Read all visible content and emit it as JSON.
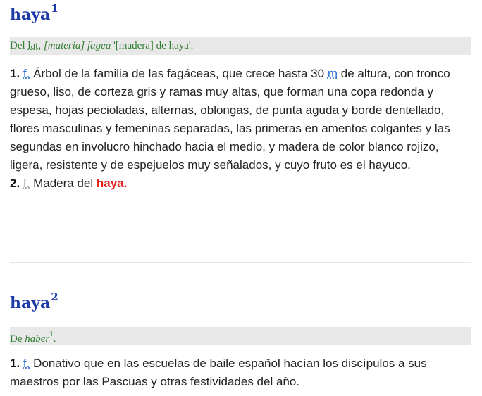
{
  "entries": [
    {
      "word": "haya",
      "sup": "1",
      "etym": {
        "pre": "Del",
        "lang_abbr": "lat.",
        "latin_word": "[materia] fagea",
        "gloss": "'[madera] de haya'."
      },
      "senses": [
        {
          "num": "1.",
          "abbr": "f.",
          "pre": "Árbol de la familia de las fagáceas, que crece hasta 30",
          "unit_abbr": "m",
          "post": "de altura, con tronco grueso, liso, de corteza gris y ramas muy altas, que forman una copa redonda y espesa, hojas pecioladas, alternas, oblongas, de punta aguda y borde dentellado, flores masculinas y femeninas separadas, las primeras en amentos colgantes y las segundas en involucro hinchado hacia el medio, y madera de color blanco rojizo, ligera, resistente y de espejuelos muy señalados, y cuyo fruto es el hayuco."
        },
        {
          "num": "2.",
          "abbr": "f.",
          "text": "Madera del",
          "link": "haya."
        }
      ]
    },
    {
      "word": "haya",
      "sup": "2",
      "etym": {
        "pre": "De",
        "origin_word": "haber",
        "origin_sup": "1",
        "post": "."
      },
      "senses": [
        {
          "num": "1.",
          "abbr": "f.",
          "text": "Donativo que en las escuelas de baile español hacían los discípulos a sus maestros por las Pascuas y otras festividades del año."
        }
      ]
    }
  ]
}
